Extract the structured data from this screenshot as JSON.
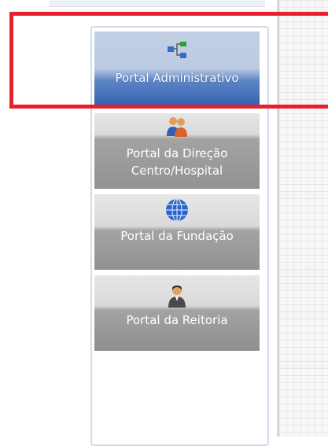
{
  "portals": [
    {
      "label": "Portal Administrativo",
      "icon": "org-chart-icon"
    },
    {
      "label": "Portal da Direção Centro/Hospital",
      "icon": "people-group-icon"
    },
    {
      "label": "Portal da Fundação",
      "icon": "globe-icon"
    },
    {
      "label": "Portal da Reitoria",
      "icon": "person-suit-icon"
    }
  ],
  "colors": {
    "selected_gradient_bottom": "#3561b0",
    "highlight_box": "#e8202e",
    "unselected_gray": "#929292"
  }
}
